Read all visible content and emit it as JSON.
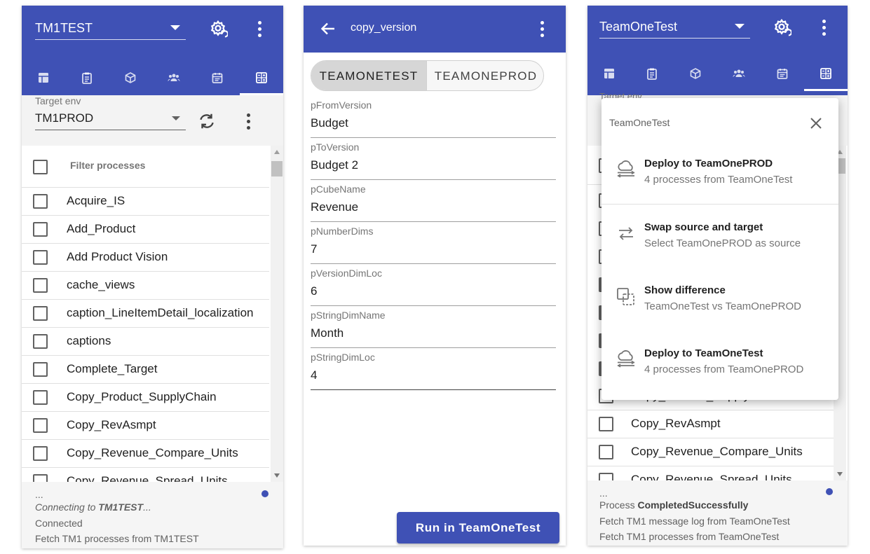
{
  "panel1": {
    "env": "TM1TEST",
    "target_label": "Target env",
    "target_value": "TM1PROD",
    "filter_placeholder": "Filter processes",
    "processes": [
      "Acquire_IS",
      "Add_Product",
      "Add Product Vision",
      "cache_views",
      "caption_LineItemDetail_localization",
      "captions",
      "Complete_Target",
      "Copy_Product_SupplyChain",
      "Copy_RevAsmpt",
      "Copy_Revenue_Compare_Units",
      "Copy_Revenue_Spread_Units"
    ],
    "footer": {
      "ellipsis": "...",
      "connecting_prefix": "Connecting to ",
      "connecting_target": "TM1TEST",
      "connecting_suffix": "...",
      "connected": "Connected",
      "fetch": "Fetch TM1 processes from TM1TEST"
    }
  },
  "panel2": {
    "title": "copy_version",
    "toggle": [
      "TEAMONETEST",
      "TEAMONEPROD"
    ],
    "toggle_selected": "TEAMONETEST",
    "fields": [
      {
        "label": "pFromVersion",
        "value": "Budget"
      },
      {
        "label": "pToVersion",
        "value": "Budget 2"
      },
      {
        "label": "pCubeName",
        "value": "Revenue"
      },
      {
        "label": "pNumberDims",
        "value": "7"
      },
      {
        "label": "pVersionDimLoc",
        "value": "6"
      },
      {
        "label": "pStringDimName",
        "value": "Month"
      },
      {
        "label": "pStringDimLoc",
        "value": "4"
      }
    ],
    "run_button": "Run in TeamOneTest"
  },
  "panel3": {
    "env": "TeamOneTest",
    "behind_label": "Target env",
    "popup": {
      "title": "TeamOneTest",
      "items": [
        {
          "title": "Deploy to TeamOnePROD",
          "subtitle": "4 processes from TeamOneTest",
          "icon": "cloud-upload-icon"
        },
        {
          "title": "Swap source and target",
          "subtitle": "Select TeamOnePROD as source",
          "icon": "swap-icon"
        },
        {
          "title": "Show difference",
          "subtitle": "TeamOneTest vs TeamOnePROD",
          "icon": "difference-icon"
        },
        {
          "title": "Deploy to TeamOneTest",
          "subtitle": "4 processes from TeamOnePROD",
          "icon": "cloud-upload-icon"
        }
      ]
    },
    "visible_processes": [
      "Copy_Product_SupplyChain",
      "Copy_RevAsmpt",
      "Copy_Revenue_Compare_Units",
      "Copy_Revenue_Spread_Units"
    ],
    "footer": {
      "ellipsis": "...",
      "status_prefix": "Process ",
      "status_value": "CompletedSuccessfully",
      "log": "Fetch TM1 message log from TeamOneTest",
      "fetch": "Fetch TM1 processes from TeamOneTest"
    }
  },
  "colors": {
    "primary": "#3f51b5",
    "accent_dot": "#3f51b5"
  }
}
